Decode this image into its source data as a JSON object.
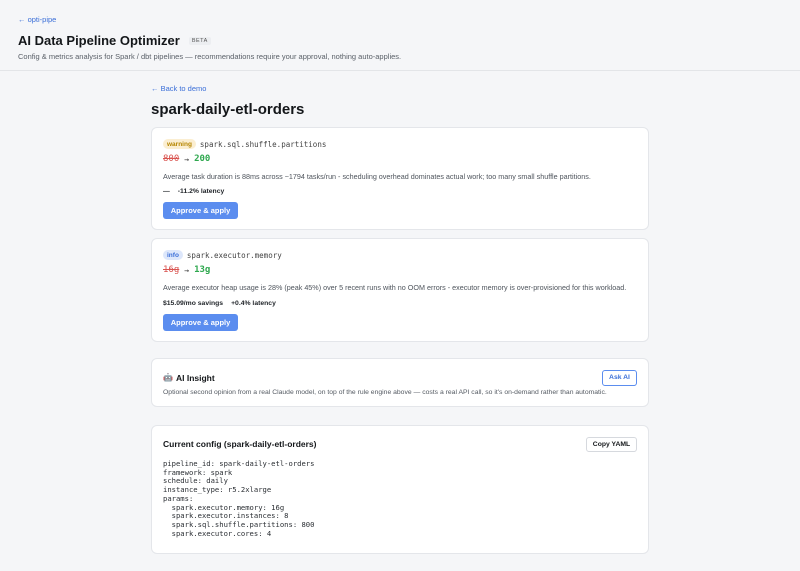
{
  "app": {
    "back_link": "← opti-pipe",
    "title": "AI Data Pipeline Optimizer",
    "beta": "BETA",
    "subtitle": "Config & metrics analysis for Spark / dbt pipelines — recommendations require your approval, nothing auto-applies."
  },
  "page": {
    "back_link": "← Back to demo",
    "title": "spark-daily-etl-orders"
  },
  "recommendations": [
    {
      "severity": "warning",
      "param": "spark.sql.shuffle.partitions",
      "old": "800",
      "arrow": "→",
      "new": "200",
      "reason": "Average task duration is 88ms across ~1794 tasks/run - scheduling overhead dominates actual work; too many small shuffle partitions.",
      "savings": "—",
      "latency": "-11.2% latency",
      "approve_label": "Approve & apply"
    },
    {
      "severity": "info",
      "param": "spark.executor.memory",
      "old": "16g",
      "arrow": "→",
      "new": "13g",
      "reason": "Average executor heap usage is 28% (peak 45%) over 5 recent runs with no OOM errors - executor memory is over-provisioned for this workload.",
      "savings": "$15.09/mo savings",
      "latency": "+0.4% latency",
      "approve_label": "Approve & apply"
    }
  ],
  "ai_insight": {
    "icon": "🤖",
    "title": "AI Insight",
    "button": "Ask AI",
    "description": "Optional second opinion from a real Claude model, on top of the rule engine above — costs a real API call, so it's on-demand rather than automatic."
  },
  "config": {
    "title": "Current config (spark-daily-etl-orders)",
    "copy_label": "Copy YAML",
    "yaml": "pipeline_id: spark-daily-etl-orders\nframework: spark\nschedule: daily\ninstance_type: r5.2xlarge\nparams:\n  spark.executor.memory: 16g\n  spark.executor.instances: 8\n  spark.sql.shuffle.partitions: 800\n  spark.executor.cores: 4"
  },
  "colors": {
    "accent": "#5b8def",
    "warning_bg": "#fbeed1",
    "warning_fg": "#b58500",
    "info_bg": "#dde7fb",
    "info_fg": "#3b6fd8",
    "old_value": "#d9534f",
    "new_value": "#2fa84f"
  }
}
